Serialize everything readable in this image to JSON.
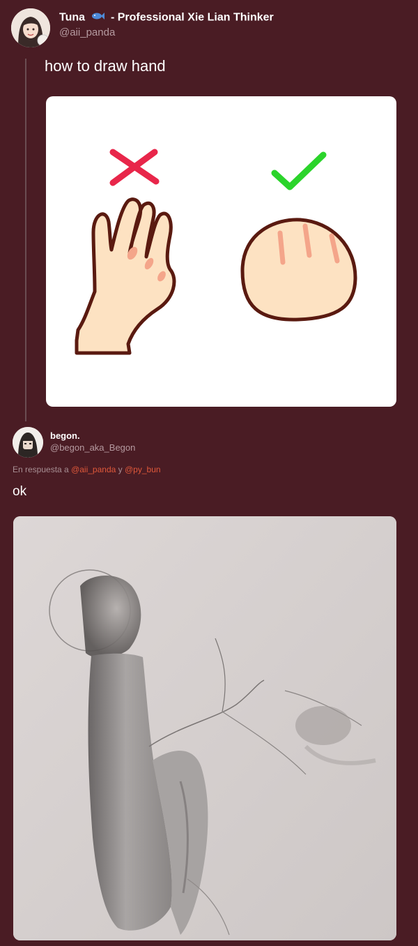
{
  "tweet": {
    "author_name": "Tuna",
    "author_suffix": "- Professional Xie Lian Thinker",
    "handle": "@aii_panda",
    "text": "how to draw hand",
    "emoji_icon": "fish-icon"
  },
  "reply": {
    "author_name": "begon.",
    "handle": "@begon_aka_Begon",
    "reply_prefix": "En respuesta a",
    "mention_1": "@aii_panda",
    "conjunction": "y",
    "mention_2": "@py_bun",
    "text": "ok"
  },
  "colors": {
    "background": "#4a1c24",
    "wrong_mark": "#e8264a",
    "right_mark": "#2bd42b",
    "skin": "#fde2c2",
    "outline": "#5a1a10",
    "mention": "#e0583a"
  }
}
